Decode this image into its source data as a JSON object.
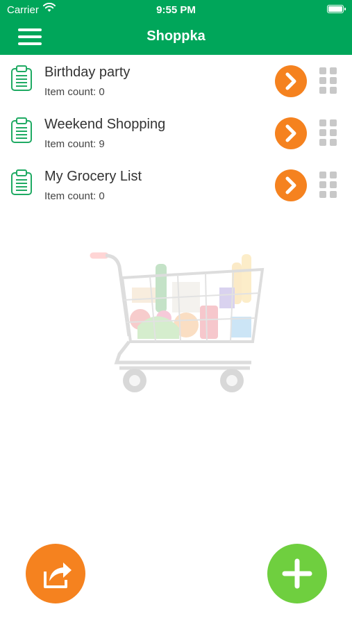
{
  "status_bar": {
    "carrier": "Carrier",
    "time": "9:55 PM"
  },
  "header": {
    "title": "Shoppka"
  },
  "lists": [
    {
      "name": "Birthday party",
      "count": "Item count: 0"
    },
    {
      "name": "Weekend Shopping",
      "count": "Item count: 9"
    },
    {
      "name": "My Grocery List",
      "count": "Item count: 0"
    }
  ],
  "icons": {
    "menu": "hamburger-menu-icon",
    "list": "clipboard-icon",
    "open": "chevron-right-icon",
    "reorder": "drag-handle-icon",
    "share": "share-icon",
    "add": "plus-icon",
    "empty_state": "shopping-cart-illustration"
  },
  "colors": {
    "primary_green": "#00a65a",
    "accent_orange": "#f5821f",
    "add_green": "#6fcf3f",
    "handle_gray": "#c8c8c8"
  }
}
